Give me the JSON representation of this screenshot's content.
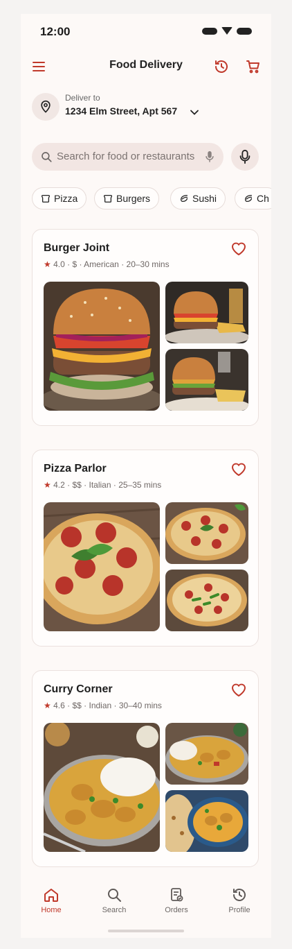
{
  "status": {
    "time": "12:00"
  },
  "header": {
    "title": "Food Delivery"
  },
  "location": {
    "label": "Deliver to",
    "address": "1234 Elm Street, Apt 567"
  },
  "search": {
    "placeholder": "Search for food or restaurants"
  },
  "chips": [
    "Pizza",
    "Burgers",
    "Sushi",
    "Ch"
  ],
  "restaurants": [
    {
      "name": "Burger Joint",
      "rating": "4.0",
      "price": "$",
      "cuisine": "American",
      "time": "20–30 mins"
    },
    {
      "name": "Pizza Parlor",
      "rating": "4.2",
      "price": "$$",
      "cuisine": "Italian",
      "time": "25–35 mins"
    },
    {
      "name": "Curry Corner",
      "rating": "4.6",
      "price": "$$",
      "cuisine": "Indian",
      "time": "30–40 mins"
    }
  ],
  "nav": {
    "home": "Home",
    "search": "Search",
    "orders": "Orders",
    "profile": "Profile"
  },
  "colors": {
    "accent": "#c0392b",
    "background": "#fdf9f7"
  }
}
